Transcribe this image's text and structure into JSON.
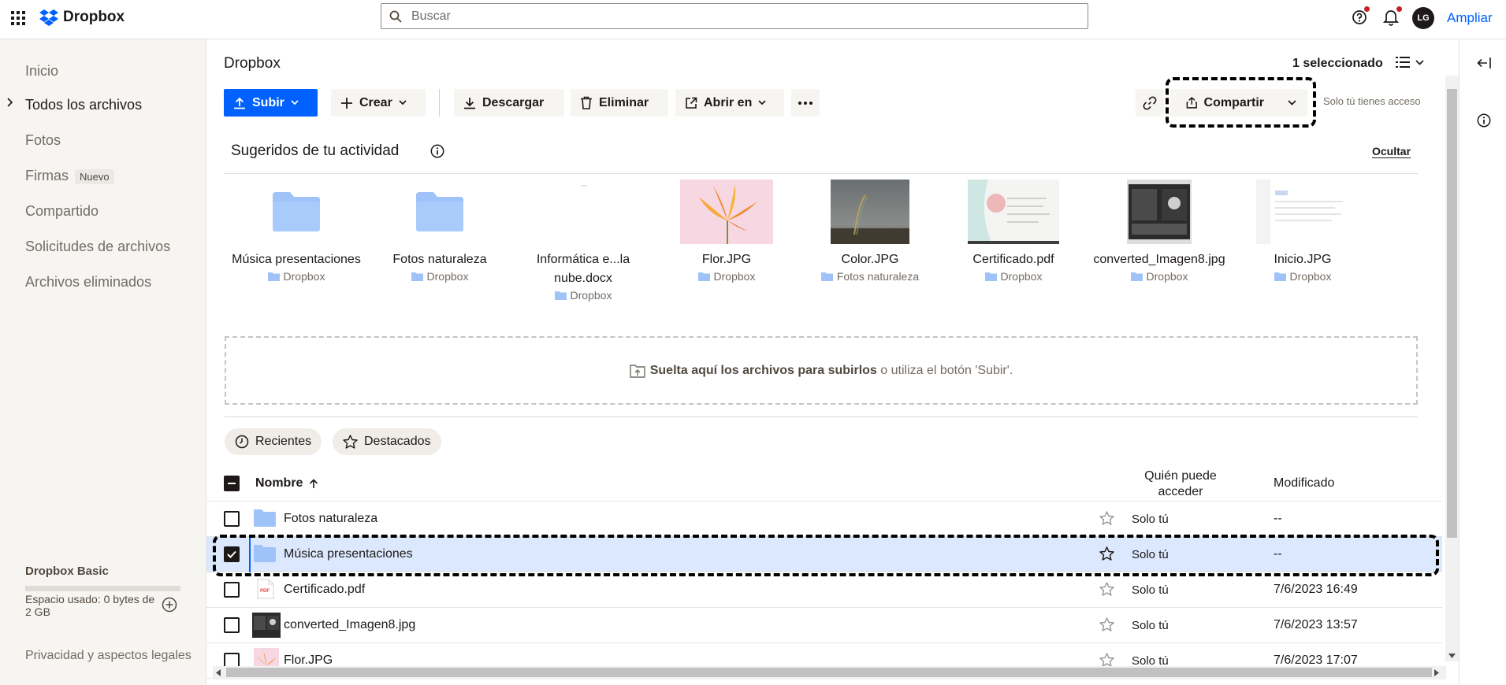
{
  "app": {
    "brand": "Dropbox",
    "upgrade_label": "Ampliar",
    "avatar_initials": "LG",
    "accent": "#0061fe"
  },
  "search": {
    "placeholder": "Buscar"
  },
  "sidebar": {
    "items": [
      {
        "label": "Inicio"
      },
      {
        "label": "Todos los archivos"
      },
      {
        "label": "Fotos"
      },
      {
        "label": "Firmas",
        "badge": "Nuevo"
      },
      {
        "label": "Compartido"
      },
      {
        "label": "Solicitudes de archivos"
      },
      {
        "label": "Archivos eliminados"
      }
    ],
    "plan": "Dropbox Basic",
    "usage": "Espacio usado: 0 bytes de 2 GB",
    "usage_fraction": 0,
    "legal": "Privacidad y aspectos legales"
  },
  "main": {
    "breadcrumb": "Dropbox",
    "selected_count": "1 seleccionado",
    "toolbar": {
      "upload": "Subir",
      "create": "Crear",
      "download": "Descargar",
      "delete": "Eliminar",
      "open_in": "Abrir en",
      "share": "Compartir",
      "access_note": "Solo tú tienes acceso"
    },
    "suggested": {
      "title": "Sugeridos de tu actividad",
      "hide": "Ocultar",
      "items": [
        {
          "name": "Música presentaciones",
          "location": "Dropbox",
          "icon": "folder-icon"
        },
        {
          "name": "Fotos naturaleza",
          "location": "Dropbox",
          "icon": "folder-icon"
        },
        {
          "name": "Informática e...la nube.docx",
          "location": "Dropbox",
          "icon": "document-thumbnail"
        },
        {
          "name": "Flor.JPG",
          "location": "Dropbox",
          "icon": "flower-thumbnail"
        },
        {
          "name": "Color.JPG",
          "location": "Fotos naturaleza",
          "icon": "rainbow-thumbnail"
        },
        {
          "name": "Certificado.pdf",
          "location": "Dropbox",
          "icon": "certificate-thumbnail"
        },
        {
          "name": "converted_Imagen8.jpg",
          "location": "Dropbox",
          "icon": "photo-thumbnail"
        },
        {
          "name": "Inicio.JPG",
          "location": "Dropbox",
          "icon": "screenshot-thumbnail"
        }
      ]
    },
    "dropzone": {
      "bold": "Suelta aquí los archivos para subirlos",
      "rest": " o utiliza el botón 'Subir'."
    },
    "filters": {
      "recent": "Recientes",
      "starred": "Destacados"
    },
    "table": {
      "headers": {
        "name": "Nombre",
        "access": "Quién puede acceder",
        "modified": "Modificado"
      },
      "rows": [
        {
          "name": "Fotos naturaleza",
          "access": "Solo tú",
          "modified": "--",
          "type": "folder",
          "selected": false,
          "starred": false
        },
        {
          "name": "Música presentaciones",
          "access": "Solo tú",
          "modified": "--",
          "type": "folder",
          "selected": true,
          "starred": false
        },
        {
          "name": "Certificado.pdf",
          "access": "Solo tú",
          "modified": "7/6/2023 16:49",
          "type": "pdf",
          "selected": false,
          "starred": false
        },
        {
          "name": "converted_Imagen8.jpg",
          "access": "Solo tú",
          "modified": "7/6/2023 13:57",
          "type": "image",
          "selected": false,
          "starred": false
        },
        {
          "name": "Flor.JPG",
          "access": "Solo tú",
          "modified": "7/6/2023 17:07",
          "type": "image",
          "selected": false,
          "starred": false
        }
      ]
    }
  }
}
